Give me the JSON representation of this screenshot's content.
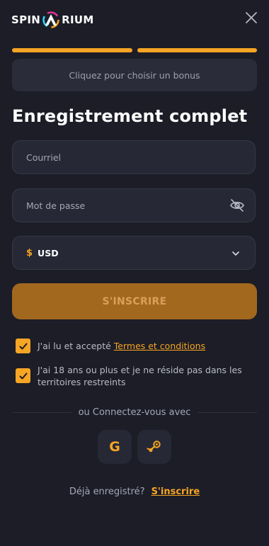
{
  "header": {
    "logo_left": "SPIN",
    "logo_right": "RIUM",
    "close_icon": "close-icon"
  },
  "progress": {
    "steps_total": 2,
    "steps_completed": 2,
    "color": "#f6a524"
  },
  "bonus": {
    "label": "Cliquez pour choisir un bonus"
  },
  "form": {
    "title": "Enregistrement complet",
    "email_placeholder": "Courriel",
    "password_placeholder": "Mot de passe",
    "password_icon": "eye-off-icon",
    "currency_symbol": "$",
    "currency_value": "USD",
    "currency_icon": "chevron-down-icon",
    "submit_label": "S'INSCRIRE"
  },
  "checks": {
    "terms_text": "J'ai lu et accepté ",
    "terms_link": "Termes et conditions",
    "terms_checked": true,
    "age_text": "J'ai 18 ans ou plus et je ne réside pas dans les territoires restreints",
    "age_checked": true
  },
  "social": {
    "divider_text": "ou Connectez-vous avec",
    "google_icon": "google-icon",
    "google_letter": "G",
    "steam_icon": "steam-icon"
  },
  "footer": {
    "question": "Déjà enregistré?",
    "link": "S'inscrire"
  },
  "colors": {
    "accent": "#f6a524",
    "background": "#1c1d27",
    "field": "#262835",
    "submit": "#a2681e"
  }
}
